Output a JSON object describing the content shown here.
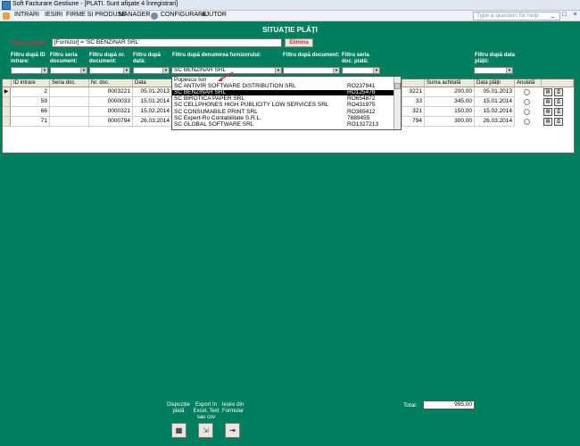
{
  "window": {
    "title": "Soft Facturare Gestiune - [PLATI. Sunt afişate 4 înregistrari]",
    "controls": [
      "_",
      "□",
      "×"
    ]
  },
  "menu": {
    "items": [
      "INTRARI",
      "IESIRI",
      "FIRME SI PRODUSE",
      "MANAGER",
      "CONFIGURARE",
      "AJUTOR"
    ],
    "help_placeholder": "Type a question for help"
  },
  "form": {
    "title": "SITUAȚIE PLĂȚI",
    "filter_applied_label": "Filtru aplicat:",
    "filter_applied_value": "[Furnizor] = 'SC BENZINAR SRL'",
    "elimina": "Elimina"
  },
  "filters": {
    "id_intrare": "Filtru după ID intrare:",
    "seria_document": "Filtru seria document:",
    "nr_document": "Filtru după nr. document:",
    "data": "Filtru după dată:",
    "denumire_furnizor": "Filtru după denumirea furnizorului:",
    "denumire_value": "SC BENZINAR SRL",
    "document": "Filtru după document:",
    "seria_plata": "Filtru seria doc. plată:",
    "data_platii": "Filtru după data plății:"
  },
  "dropdown_items": [
    {
      "name": "Popescu Ion",
      "code": ""
    },
    {
      "name": "SC ANTIVIR SOFTWARE DISTRIBUTION SRL",
      "code": "RO237941"
    },
    {
      "name": "SC BENZINAR SRL",
      "code": "RO125478"
    },
    {
      "name": "SC BIROTICA PAPER SRL",
      "code": "RO654872"
    },
    {
      "name": "SC CELLPHONES HIGH PUBLICITY LOW SERVICES SRL",
      "code": "RO431975"
    },
    {
      "name": "SC CONSUMABILE PRINT SRL",
      "code": "RO365412"
    },
    {
      "name": "SC Expert-Ro Contabilitate S.R.L.",
      "code": "7889455"
    },
    {
      "name": "SC GLOBAL SOFTWARE SRL",
      "code": "RO1327213"
    }
  ],
  "table": {
    "headers": {
      "id": "ID intrare",
      "seria": "Seria doc.",
      "nr": "Nr. doc.",
      "data": "Data",
      "suma": "Suma achitată",
      "data_plata": "Data plății",
      "anulata": "Anulată"
    },
    "rows": [
      {
        "id": "2",
        "seria": "",
        "nr": "0003221",
        "data": "05.01.2013",
        "doc": "3221",
        "suma": "200,00",
        "data_plata": "05.01.2013"
      },
      {
        "id": "59",
        "seria": "",
        "nr": "0000033",
        "data": "15.01.2014",
        "doc": "33",
        "suma": "345,00",
        "data_plata": "15.01.2014"
      },
      {
        "id": "66",
        "seria": "",
        "nr": "0000321",
        "data": "15.02.2014",
        "doc": "321",
        "suma": "150,00",
        "data_plata": "15.02.2014"
      },
      {
        "id": "71",
        "seria": "",
        "nr": "0000794",
        "data": "26.03.2014",
        "doc": "794",
        "suma": "300,00",
        "data_plata": "26.03.2014"
      }
    ]
  },
  "bottom": {
    "dispozitie": "Dispoziție plată",
    "export": "Export în Excel, Text sau csv",
    "iesire": "Ieșire din Formular",
    "total_label": "Total:",
    "total_value": "995,00"
  }
}
